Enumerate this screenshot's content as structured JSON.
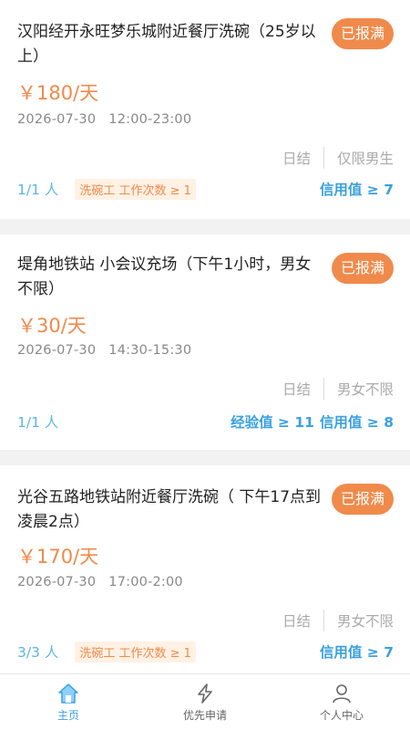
{
  "jobs": [
    {
      "title": "汉阳经开永旺梦乐城附近餐厅洗碗（25岁以上）",
      "badge": "已报满",
      "price": "￥180/天",
      "date": "2026-07-30",
      "time": "12:00-23:00",
      "pay_type": "日结",
      "gender": "仅限男生",
      "people": "1/1 人",
      "role_tag": "洗碗工 工作次数 ≥ 1",
      "requirements": [
        "信用值 ≥ 7"
      ]
    },
    {
      "title": "堤角地铁站 小会议充场（下午1小时，男女不限）",
      "badge": "已报满",
      "price": "￥30/天",
      "date": "2026-07-30",
      "time": "14:30-15:30",
      "pay_type": "日结",
      "gender": "男女不限",
      "people": "1/1 人",
      "role_tag": "",
      "requirements": [
        "经验值 ≥ 11",
        "信用值 ≥ 8"
      ]
    },
    {
      "title": "光谷五路地铁站附近餐厅洗碗（ 下午17点到凌晨2点）",
      "badge": "已报满",
      "price": "￥170/天",
      "date": "2026-07-30",
      "time": "17:00-2:00",
      "pay_type": "日结",
      "gender": "男女不限",
      "people": "3/3 人",
      "role_tag": "洗碗工 工作次数 ≥ 1",
      "requirements": [
        "信用值 ≥ 7"
      ]
    }
  ],
  "nav": {
    "home": "主页",
    "priority": "优先申请",
    "profile": "个人中心",
    "active_color": "#3aa0e0",
    "icons": [
      "home-icon",
      "lightning-icon",
      "person-icon"
    ]
  },
  "colors": {
    "accent_orange": "#f08a4b",
    "accent_blue": "#3aa0e0"
  }
}
